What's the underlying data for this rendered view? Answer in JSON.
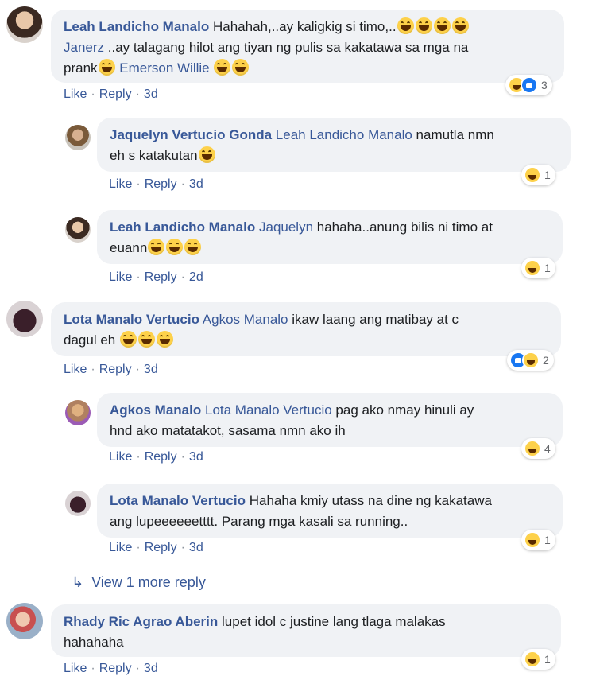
{
  "comments": [
    {
      "author": "Leah Landicho Manalo",
      "line1_text": "Hahahah,..ay kaligkig si timo,..",
      "line2_mention": "Janerz",
      "line2_text": " ..ay talagang hilot ang tiyan ng pulis sa kakatawa sa mga na",
      "line3_text": "prank",
      "line3_mention": "Emerson Willie",
      "actions": {
        "like": "Like",
        "reply": "Reply",
        "time": "3d"
      },
      "reaction_count": "3"
    },
    {
      "author": "Jaquelyn Vertucio Gonda",
      "mention": "Leah Landicho Manalo",
      "text1": " namutla nmn",
      "text2": "eh s katakutan",
      "actions": {
        "like": "Like",
        "reply": "Reply",
        "time": "3d"
      },
      "reaction_count": "1"
    },
    {
      "author": "Leah Landicho Manalo",
      "mention": "Jaquelyn",
      "text1": " hahaha..anung bilis ni timo at",
      "text2": "euann",
      "actions": {
        "like": "Like",
        "reply": "Reply",
        "time": "2d"
      },
      "reaction_count": "1"
    },
    {
      "author": "Lota Manalo Vertucio",
      "mention": "Agkos Manalo",
      "text1": " ikaw laang ang matibay at c",
      "text2": "dagul eh",
      "actions": {
        "like": "Like",
        "reply": "Reply",
        "time": "3d"
      },
      "reaction_count": "2"
    },
    {
      "author": "Agkos Manalo",
      "mention": "Lota Manalo Vertucio",
      "text1": " pag ako nmay hinuli ay",
      "text2": "hnd ako matatakot, sasama nmn ako ih",
      "actions": {
        "like": "Like",
        "reply": "Reply",
        "time": "3d"
      },
      "reaction_count": "4"
    },
    {
      "author": "Lota Manalo Vertucio",
      "text1": " Hahaha kmiy utass na dine ng kakatawa",
      "text2": "ang lupeeeeeetttt. Parang mga kasali sa running..",
      "actions": {
        "like": "Like",
        "reply": "Reply",
        "time": "3d"
      },
      "reaction_count": "1"
    },
    {
      "author": "Rhady Ric Agrao Aberin",
      "text1": " lupet idol c justine lang tlaga malakas",
      "text2": "hahahaha",
      "actions": {
        "like": "Like",
        "reply": "Reply",
        "time": "3d"
      },
      "reaction_count": "1"
    }
  ],
  "view_more": "View 1 more reply",
  "icons": {
    "haha": "haha-emoji",
    "like": "like-reaction",
    "reply_arrow": "reply-arrow-icon"
  },
  "colors": {
    "link": "#385898",
    "bubble": "#f0f2f5",
    "meta": "#65676b",
    "like_blue": "#1877f2",
    "haha_yellow": "#fdd14a"
  }
}
